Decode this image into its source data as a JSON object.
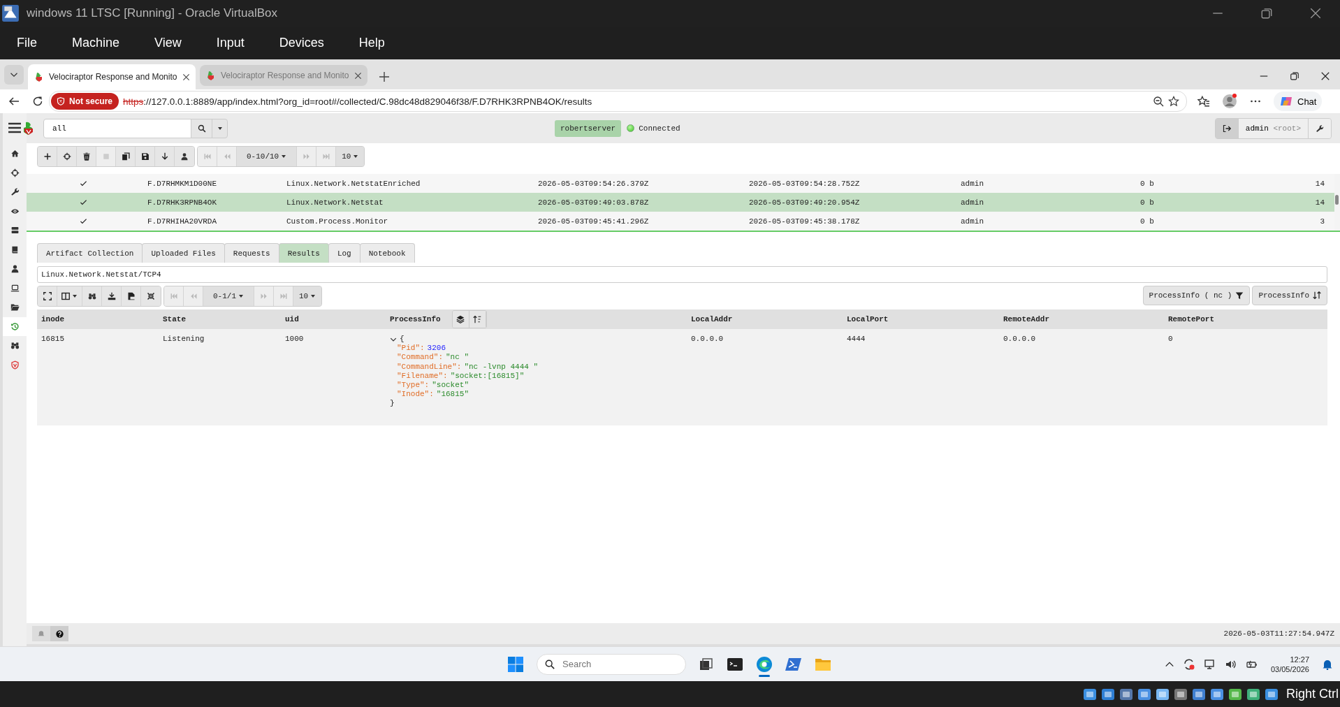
{
  "vm_window": {
    "title": "windows 11 LTSC [Running] - Oracle VirtualBox",
    "menu": [
      "File",
      "Machine",
      "View",
      "Input",
      "Devices",
      "Help"
    ]
  },
  "browser": {
    "tabs": [
      {
        "title": "Velociraptor Response and Monito",
        "selected": true
      },
      {
        "title": "Velociraptor Response and Monito",
        "selected": false
      }
    ],
    "security_badge": "Not secure",
    "url": {
      "scheme": "https",
      "rest": "://127.0.0.1:8889/app/index.html?org_id=root#/collected/C.98dc48d829046f38/F.D7RHK3RPNB4OK/results"
    },
    "chat_label": "Chat"
  },
  "app": {
    "sidebar": {
      "items": [
        {
          "selected": false
        },
        {
          "selected": false
        },
        {
          "selected": false
        },
        {
          "selected": false
        },
        {
          "selected": false
        },
        {
          "selected": false
        },
        {
          "selected": false
        },
        {
          "selected": false
        },
        {
          "selected": false
        },
        {
          "selected": true
        },
        {
          "selected": false
        },
        {
          "selected": false
        }
      ]
    },
    "search": {
      "value": "all"
    },
    "server": "robertserver",
    "connection": {
      "label": "Connected",
      "connected": true
    },
    "user": {
      "name": "admin",
      "org": "<root>"
    },
    "flows_pager": {
      "range": "0-10/10",
      "page_size": "10"
    },
    "flows": [
      {
        "finished": true,
        "flow_id": "F.D7RHMKM1D00NE",
        "artifact": "Linux.Network.NetstatEnriched",
        "created": "2026-05-03T09:54:26.379Z",
        "last_active": "2026-05-03T09:54:28.752Z",
        "creator": "admin",
        "uploaded": "0 b",
        "rows": "14",
        "selected": false
      },
      {
        "finished": true,
        "flow_id": "F.D7RHK3RPNB4OK",
        "artifact": "Linux.Network.Netstat",
        "created": "2026-05-03T09:49:03.878Z",
        "last_active": "2026-05-03T09:49:20.954Z",
        "creator": "admin",
        "uploaded": "0 b",
        "rows": "14",
        "selected": true
      },
      {
        "finished": true,
        "flow_id": "F.D7RHIHA20VRDA",
        "artifact": "Custom.Process.Monitor",
        "created": "2026-05-03T09:45:41.296Z",
        "last_active": "2026-05-03T09:45:38.178Z",
        "creator": "admin",
        "uploaded": "0 b",
        "rows": "3",
        "selected": false
      }
    ],
    "detail_tabs": [
      {
        "label": "Artifact Collection",
        "selected": false
      },
      {
        "label": "Uploaded Files",
        "selected": false
      },
      {
        "label": "Requests",
        "selected": false
      },
      {
        "label": "Results",
        "selected": true
      },
      {
        "label": "Log",
        "selected": false
      },
      {
        "label": "Notebook",
        "selected": false
      }
    ],
    "artifact_path": "Linux.Network.Netstat/TCP4",
    "results_pager": {
      "range": "0-1/1",
      "page_size": "10"
    },
    "results_actions": [
      {
        "kind": "filter",
        "label": "ProcessInfo ( nc )"
      },
      {
        "kind": "sort",
        "label": "ProcessInfo"
      }
    ],
    "results": {
      "columns": [
        "inode",
        "State",
        "uid",
        "ProcessInfo",
        "LocalAddr",
        "LocalPort",
        "RemoteAddr",
        "RemotePort"
      ],
      "rows": [
        {
          "inode": "16815",
          "state": "Listening",
          "uid": "1000",
          "process_info": {
            "expanded": true,
            "open": "{",
            "close": "}",
            "fields": [
              {
                "key": "\"Pid\":",
                "value": "3206",
                "kind": "number"
              },
              {
                "key": "\"Command\":",
                "value": "\"nc \"",
                "kind": "string"
              },
              {
                "key": "\"CommandLine\":",
                "value": "\"nc -lvnp 4444 \"",
                "kind": "string"
              },
              {
                "key": "\"Filename\":",
                "value": "\"socket:[16815]\"",
                "kind": "string"
              },
              {
                "key": "\"Type\":",
                "value": "\"socket\"",
                "kind": "string"
              },
              {
                "key": "\"Inode\":",
                "value": "\"16815\"",
                "kind": "string"
              }
            ]
          },
          "local_addr": "0.0.0.0",
          "local_port": "4444",
          "remote_addr": "0.0.0.0",
          "remote_port": "0"
        }
      ]
    },
    "footer_time": "2026-05-03T11:27:54.947Z"
  },
  "taskbar": {
    "search_placeholder": "Search",
    "time": "12:27",
    "date": "03/05/2026"
  },
  "vm_status": {
    "host_key": "Right Ctrl"
  }
}
